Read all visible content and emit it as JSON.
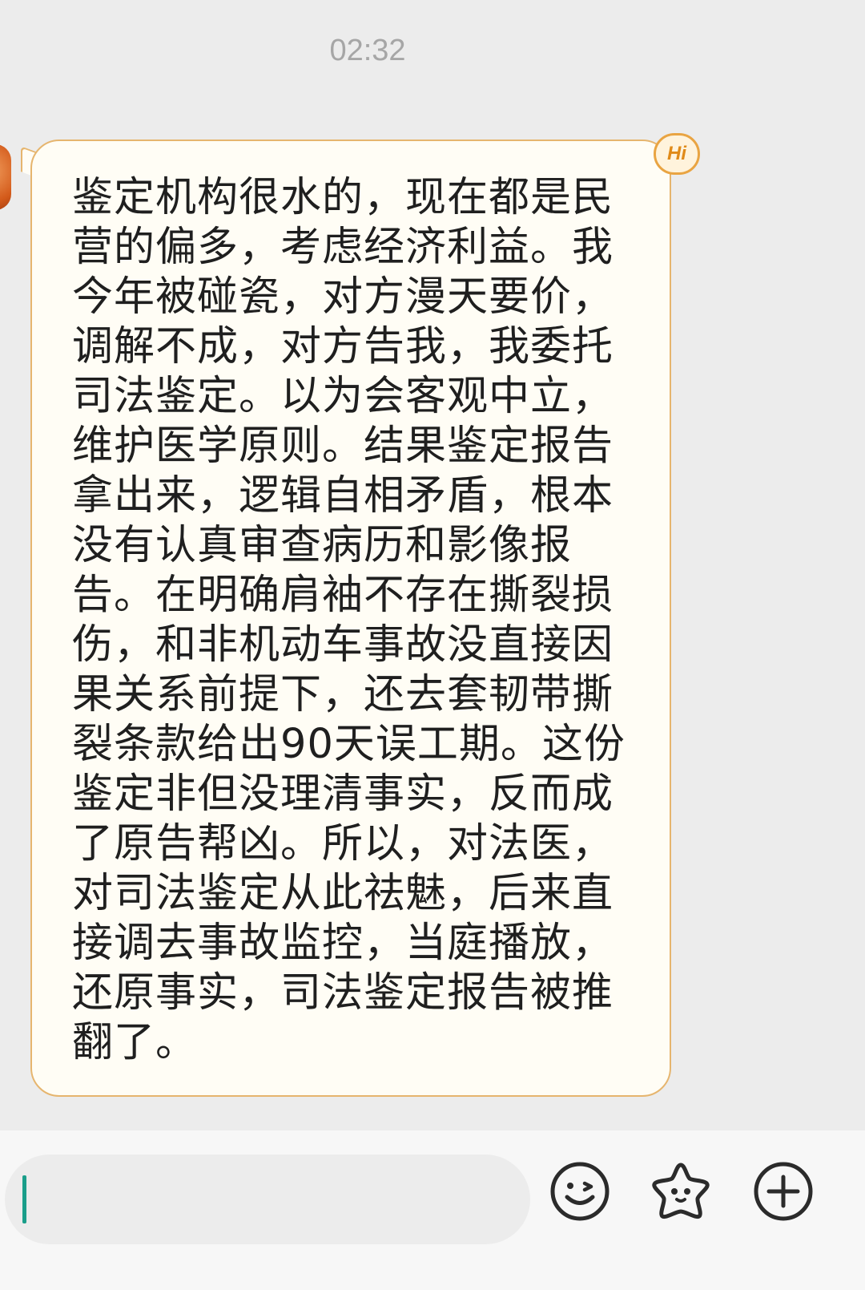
{
  "header": {
    "timestamp": "02:32"
  },
  "message": {
    "badge": "Hi",
    "text": "鉴定机构很水的，现在都是民营的偏多，考虑经济利益。我今年被碰瓷，对方漫天要价，调解不成，对方告我，我委托司法鉴定。以为会客观中立，维护医学原则。结果鉴定报告拿出来，逻辑自相矛盾，根本没有认真审查病历和影像报告。在明确肩袖不存在撕裂损伤，和非机动车事故没直接因果关系前提下，还去套韧带撕裂条款给出90天误工期。这份鉴定非但没理清事实，反而成了原告帮凶。所以，对法医，对司法鉴定从此祛魅，后来直接调去事故监控，当庭播放，还原事实，司法鉴定报告被推翻了。"
  },
  "composer": {
    "input_value": "",
    "icons": [
      "smiley-icon",
      "star-face-icon",
      "plus-circle-icon"
    ]
  }
}
